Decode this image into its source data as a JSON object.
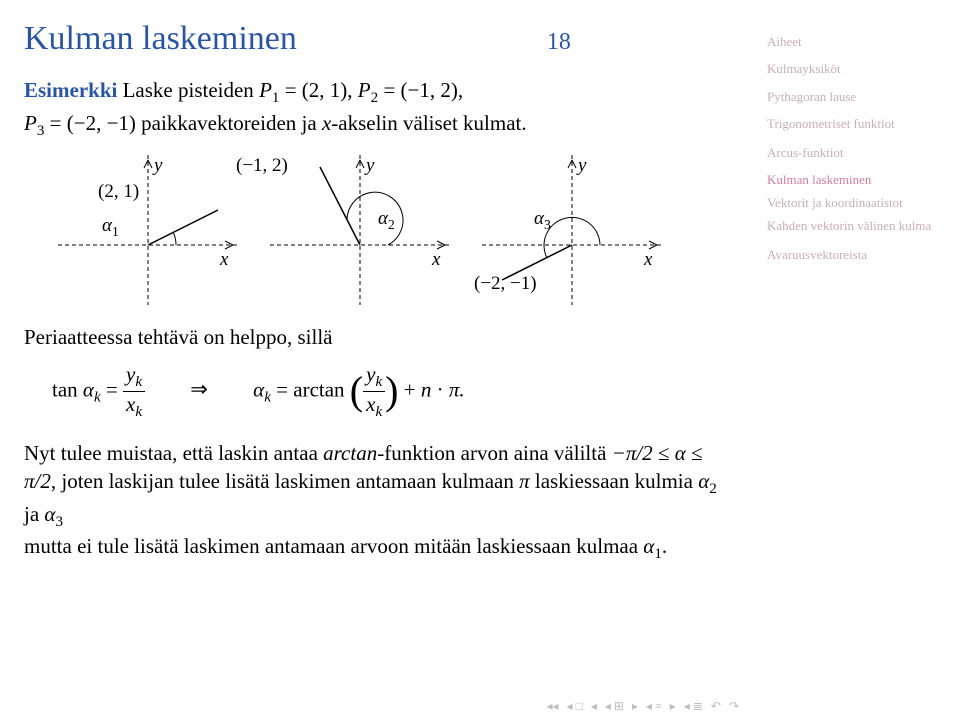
{
  "title": "Kulman laskeminen",
  "slide_number": "18",
  "example_label": "Esimerkki",
  "example_text_a": " Laske pisteiden ",
  "p1": "P",
  "p1_sub": "1",
  "eq": " = ",
  "p1_val": "(2, 1)",
  "comma": ", ",
  "p2": "P",
  "p2_sub": "2",
  "p2_val": "(−1, 2)",
  "example_text_b": " paikkavektoreiden ja ",
  "p3": "P",
  "p3_sub": "3",
  "p3_val": "(−2, −1)",
  "xaxis": "x",
  "axis_rest": "-akselin väliset kulmat.",
  "diagram": {
    "y": "y",
    "x": "x",
    "pt1": "(2, 1)",
    "a1": "α",
    "a1s": "1",
    "pt2": "(−1, 2)",
    "a2": "α",
    "a2s": "2",
    "pt3": "(−2, −1)",
    "a3": "α",
    "a3s": "3"
  },
  "principle": "Periaatteessa tehtävä on helppo, sillä",
  "formula": {
    "tan": "tan ",
    "ak": "α",
    "ks": "k",
    "yk": "y",
    "xk": "x",
    "arrow": "⇒",
    "arctan": "arctan",
    "plus": " + ",
    "n": "n",
    "dot": " · ",
    "pi": "π."
  },
  "para2_a": "Nyt tulee muistaa, että laskin antaa ",
  "para2_ital": "arctan",
  "para2_b": "-funktion arvon aina väliltä ",
  "range": "−π/2 ≤ α ≤ π/2",
  "para2_c": ", joten laskijan tulee lisätä laskimen antamaan kulmaan ",
  "pi": "π",
  "para2_d": " laskiessaan kulmia ",
  "a2": "α",
  "s2": "2",
  "ja": " ja ",
  "a3": "α",
  "s3": "3",
  "para2_e": " mutta ei tule lisätä laskimen antamaan arvoon mitään laskiessaan kulmaa ",
  "a1": "α",
  "s1": "1",
  "period": ".",
  "sidebar": {
    "items": [
      "Aiheet",
      "Kulmayksiköt",
      "Pythagoran lause",
      "Trigonometriset funktiot",
      "Arcus-funktiot",
      "Kulman laskeminen",
      "Vektorit ja koordinaatistot",
      "Kahden vektorin välinen kulma",
      "Avaruusvektoreista"
    ],
    "active_index": 5
  },
  "nav": {
    "first": "◂◂",
    "prev": "◂",
    "up": "▴",
    "next": "▸",
    "last": "▸▸",
    "back": "↶",
    "fwd": "↷"
  }
}
